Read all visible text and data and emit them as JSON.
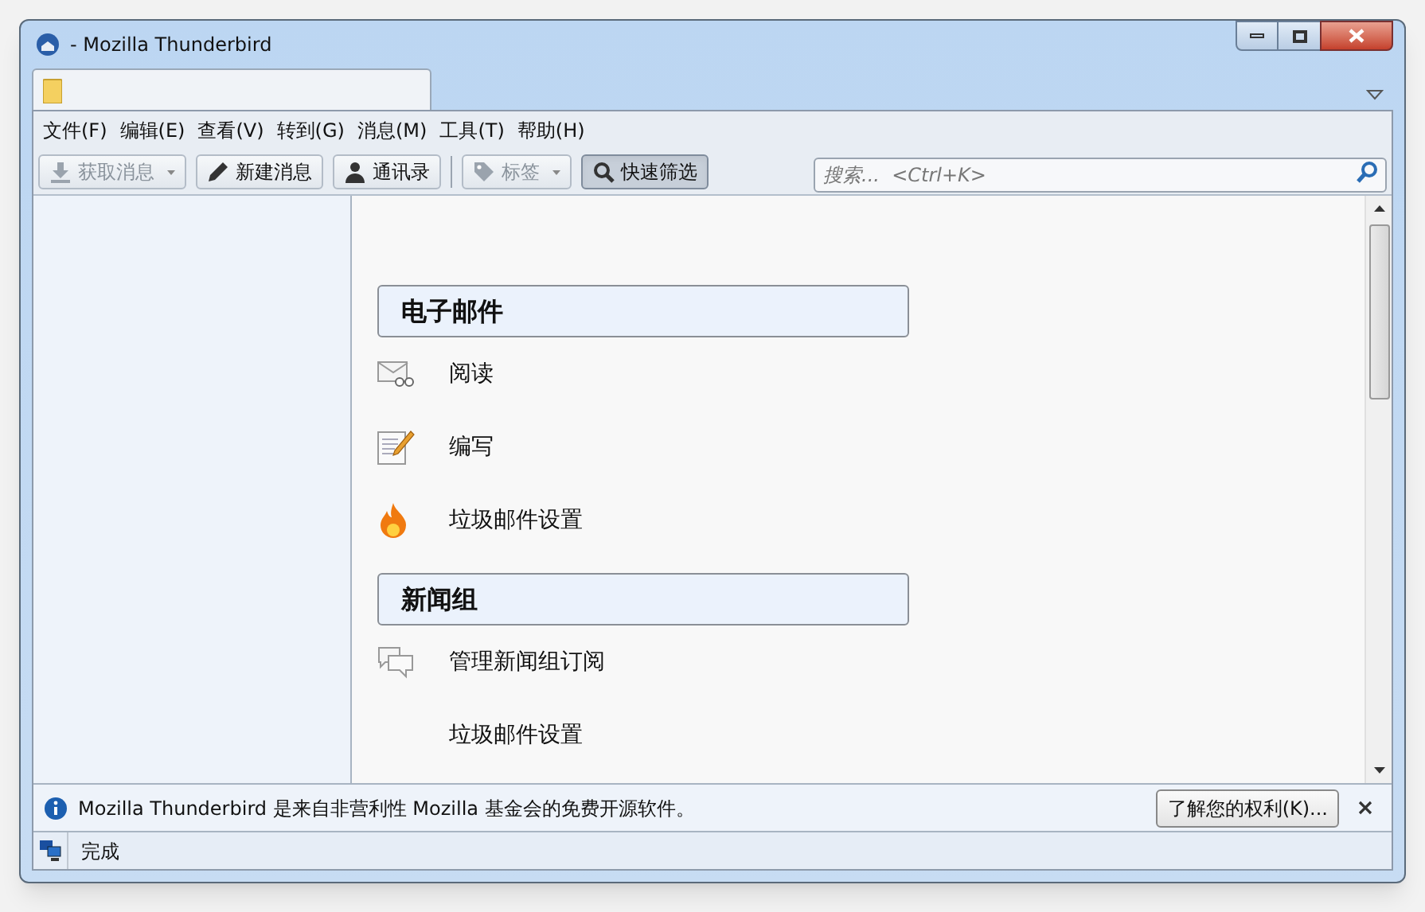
{
  "window": {
    "title": "- Mozilla Thunderbird"
  },
  "menu": [
    "文件(F)",
    "编辑(E)",
    "查看(V)",
    "转到(G)",
    "消息(M)",
    "工具(T)",
    "帮助(H)"
  ],
  "toolbar": [
    {
      "kind": "download",
      "label": "获取消息",
      "disabled": true,
      "dropdown": true,
      "pressed": false
    },
    {
      "kind": "pencil",
      "label": "新建消息",
      "disabled": false,
      "dropdown": false,
      "pressed": false
    },
    {
      "kind": "person",
      "label": "通讯录",
      "disabled": false,
      "dropdown": false,
      "pressed": false
    },
    {
      "kind": "tag",
      "label": "标签",
      "disabled": true,
      "dropdown": true,
      "pressed": false
    },
    {
      "kind": "search",
      "label": "快速筛选",
      "disabled": false,
      "dropdown": false,
      "pressed": true
    }
  ],
  "search": {
    "placeholder": "搜索...  <Ctrl+K>"
  },
  "sections": [
    {
      "title": "电子邮件",
      "items": [
        {
          "kind": "read",
          "label": "阅读"
        },
        {
          "kind": "compose",
          "label": "编写"
        },
        {
          "kind": "junk",
          "label": "垃圾邮件设置"
        }
      ]
    },
    {
      "title": "新闻组",
      "items": [
        {
          "kind": "subscribe",
          "label": "管理新闻组订阅"
        },
        {
          "kind": "plain",
          "label": "垃圾邮件设置"
        }
      ]
    }
  ],
  "notification": {
    "message": "Mozilla Thunderbird 是来自非营利性 Mozilla 基金会的免费开源软件。",
    "button": "了解您的权利(K)..."
  },
  "status_bar": {
    "text": "完成"
  }
}
